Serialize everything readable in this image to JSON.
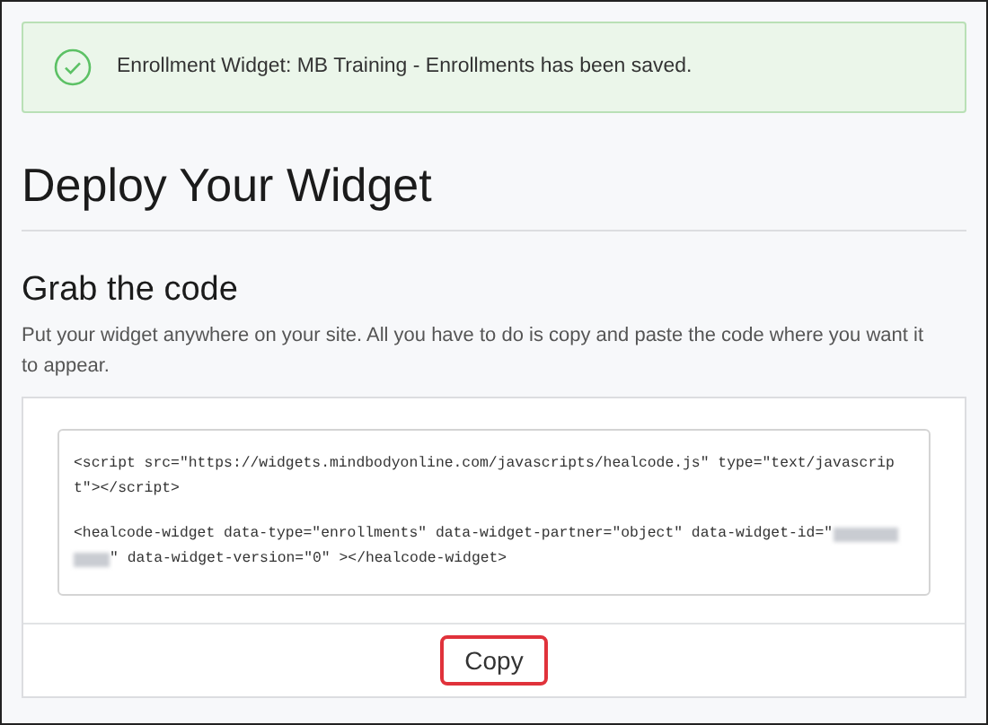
{
  "alert": {
    "message": "Enrollment Widget: MB Training - Enrollments has been saved."
  },
  "title": "Deploy Your Widget",
  "section": {
    "heading": "Grab the code",
    "description": "Put your widget anywhere on your site. All you have to do is copy and paste the code where you want it to appear."
  },
  "code_blocks": [
    {
      "lines": [
        {
          "text": "<script src=\"https://widgets.mindbodyonline.com/javascripts/healcode.js\" type=\"text/javascrip",
          "redacted": false
        },
        {
          "text": "t\"></script>",
          "redacted": false
        }
      ]
    },
    {
      "lines": [
        {
          "text": "<healcode-widget data-type=\"enrollments\" data-widget-partner=\"object\" data-widget-id=\"",
          "redacted": true
        },
        {
          "text": "\" data-widget-version=\"0\" ></healcode-widget>",
          "redacted": true
        }
      ]
    }
  ],
  "copy_button": {
    "label": "Copy",
    "highlighted": true
  }
}
